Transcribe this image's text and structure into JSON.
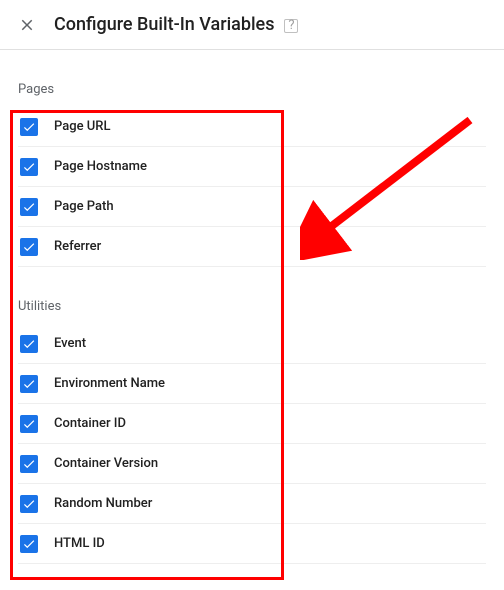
{
  "header": {
    "title": "Configure Built-In Variables"
  },
  "sections": {
    "pages": {
      "label": "Pages",
      "items": [
        {
          "label": "Page URL"
        },
        {
          "label": "Page Hostname"
        },
        {
          "label": "Page Path"
        },
        {
          "label": "Referrer"
        }
      ]
    },
    "utilities": {
      "label": "Utilities",
      "items": [
        {
          "label": "Event"
        },
        {
          "label": "Environment Name"
        },
        {
          "label": "Container ID"
        },
        {
          "label": "Container Version"
        },
        {
          "label": "Random Number"
        },
        {
          "label": "HTML ID"
        }
      ]
    }
  }
}
